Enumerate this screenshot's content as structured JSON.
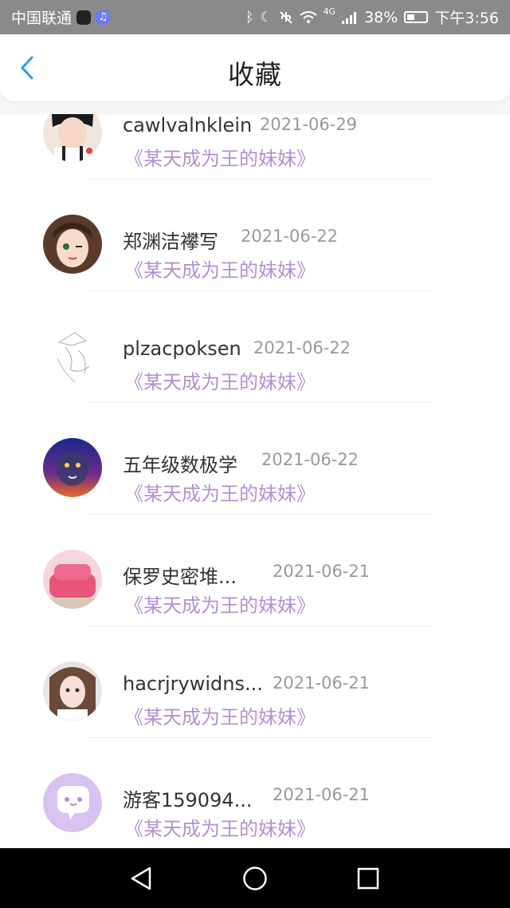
{
  "status_bar": {
    "carrier": "中国联通",
    "network": "4G",
    "battery": "38%",
    "time": "下午3:56",
    "icons": [
      "tiktok-icon",
      "music-app-icon",
      "bluetooth-icon",
      "moon-icon",
      "mute-icon",
      "wifi-icon",
      "signal-icon",
      "battery-icon"
    ]
  },
  "header": {
    "title": "收藏",
    "back_icon": "chevron-left-icon",
    "accent_color": "#2a9df4"
  },
  "book_color": "#b48fd4",
  "items": [
    {
      "name": "cawlvalnklein",
      "date": "2021-06-29",
      "book": "《某天成为王的妹妹》",
      "avatar": "avatar-1"
    },
    {
      "name": "郑渊洁襻写",
      "date": "2021-06-22",
      "book": "《某天成为王的妹妹》",
      "avatar": "avatar-2"
    },
    {
      "name": "plzacpoksen",
      "date": "2021-06-22",
      "book": "《某天成为王的妹妹》",
      "avatar": "avatar-3"
    },
    {
      "name": "五年级数极学",
      "date": "2021-06-22",
      "book": "《某天成为王的妹妹》",
      "avatar": "avatar-4"
    },
    {
      "name": "保罗史密堆...",
      "date": "2021-06-21",
      "book": "《某天成为王的妹妹》",
      "avatar": "avatar-5"
    },
    {
      "name": "hacrjrywidns...",
      "date": "2021-06-21",
      "book": "《某天成为王的妹妹》",
      "avatar": "avatar-6"
    },
    {
      "name": "游客159094...",
      "date": "2021-06-21",
      "book": "《某天成为王的妹妹》",
      "avatar": "avatar-7"
    }
  ],
  "nav_bar": {
    "icons": [
      "back-triangle-icon",
      "home-circle-icon",
      "recents-square-icon"
    ]
  }
}
